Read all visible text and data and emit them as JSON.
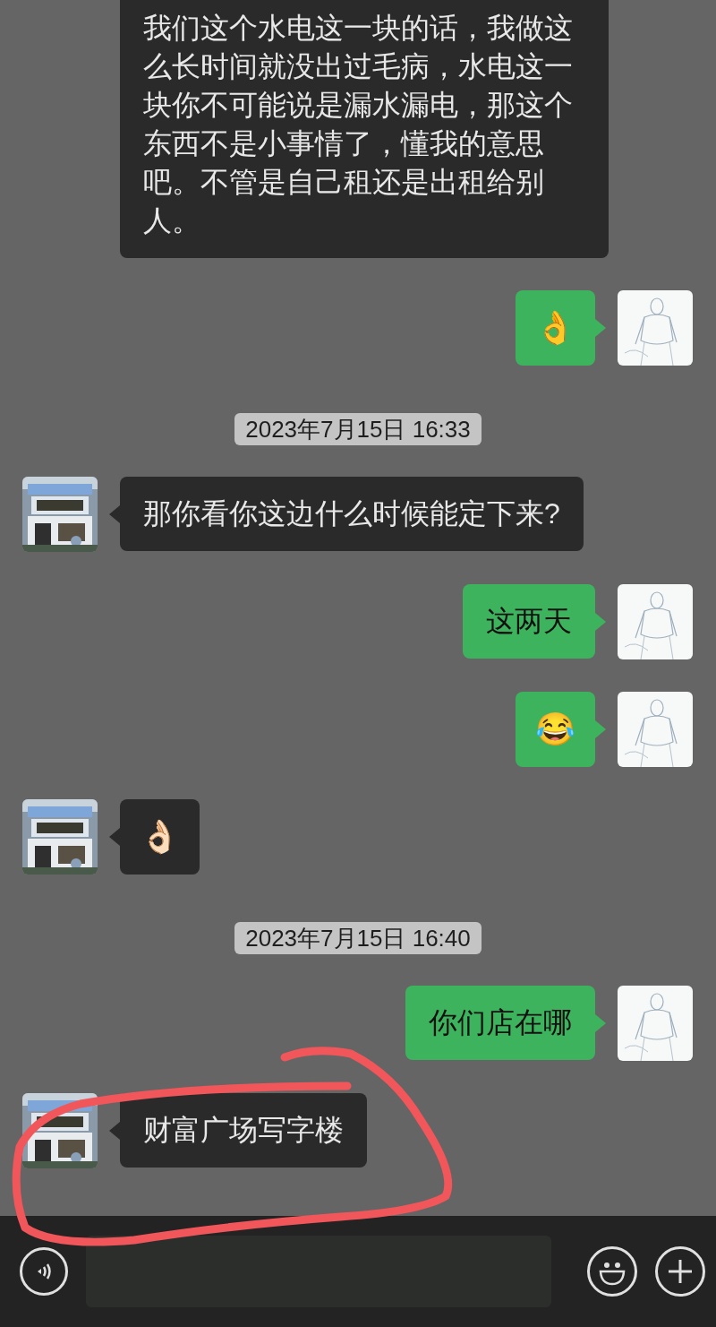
{
  "messages": [
    {
      "kind": "text",
      "outgoing": false,
      "avatar": false,
      "text": "我们这个水电这一块的话，我做这么长时间就没出过毛病，水电这一块你不可能说是漏水漏电，那这个东西不是小事情了，懂我的意思吧。不管是自己租还是出租给别人。"
    },
    {
      "kind": "emoji",
      "outgoing": true,
      "avatar": true,
      "text": "👌"
    },
    {
      "kind": "time",
      "text": "2023年7月15日 16:33"
    },
    {
      "kind": "text",
      "outgoing": false,
      "avatar": true,
      "text": "那你看你这边什么时候能定下来?"
    },
    {
      "kind": "text",
      "outgoing": true,
      "avatar": true,
      "text": "这两天"
    },
    {
      "kind": "emoji",
      "outgoing": true,
      "avatar": true,
      "text": "😂"
    },
    {
      "kind": "emoji",
      "outgoing": false,
      "avatar": true,
      "text": "👌🏻"
    },
    {
      "kind": "time",
      "text": "2023年7月15日 16:40"
    },
    {
      "kind": "text",
      "outgoing": true,
      "avatar": true,
      "text": "你们店在哪"
    },
    {
      "kind": "text",
      "outgoing": false,
      "avatar": true,
      "text": "财富广场写字楼"
    }
  ],
  "annotation": {
    "kind": "circle"
  }
}
